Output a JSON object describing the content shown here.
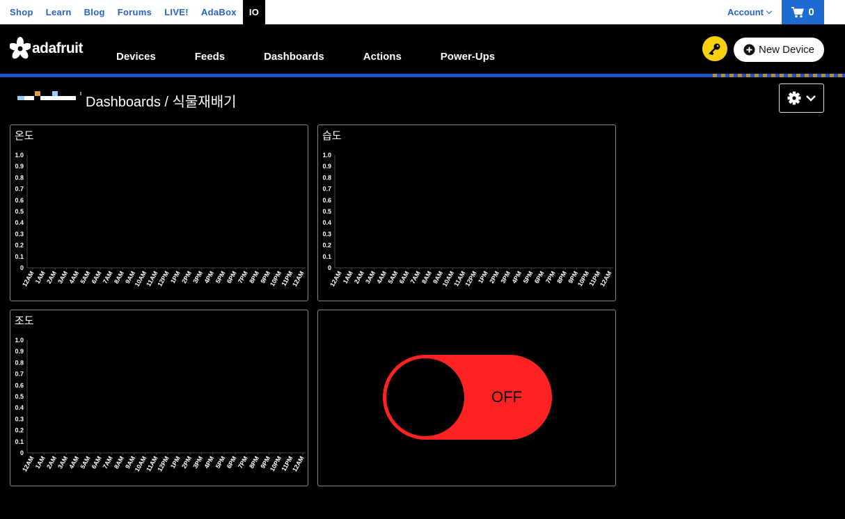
{
  "topnav": {
    "links": [
      "Shop",
      "Learn",
      "Blog",
      "Forums",
      "LIVE!",
      "AdaBox",
      "IO"
    ],
    "active": "IO",
    "account_label": "Account",
    "cart_count": "0"
  },
  "header": {
    "logo_text": "adafruit",
    "nav": [
      "Devices",
      "Feeds",
      "Dashboards",
      "Actions",
      "Power-Ups"
    ],
    "new_device_label": "New Device"
  },
  "breadcrumb": {
    "text": "Dashboards / 식물재배기"
  },
  "colors": {
    "accent_blue": "#1a56c5",
    "link_blue": "#2a62c4",
    "key_yellow": "#f7d10b",
    "toggle_red": "#ff2222"
  },
  "blocks": [
    {
      "title": "온도"
    },
    {
      "title": "습도"
    },
    {
      "title": "조도"
    },
    {
      "toggle_label": "OFF",
      "toggle_state": "off"
    }
  ],
  "chart_data": [
    {
      "type": "line",
      "title": "온도",
      "categories": [
        "12AM",
        "1AM",
        "2AM",
        "3AM",
        "4AM",
        "5AM",
        "6AM",
        "7AM",
        "8AM",
        "9AM",
        "10AM",
        "11AM",
        "12PM",
        "1PM",
        "2PM",
        "3PM",
        "4PM",
        "5PM",
        "6PM",
        "7PM",
        "8PM",
        "9PM",
        "10PM",
        "11PM",
        "12AM"
      ],
      "yticks": [
        "0",
        "0.1",
        "0.2",
        "0.3",
        "0.4",
        "0.5",
        "0.6",
        "0.7",
        "0.8",
        "0.9",
        "1.0"
      ],
      "ylim": [
        0,
        1
      ],
      "series": []
    },
    {
      "type": "line",
      "title": "습도",
      "categories": [
        "12AM",
        "1AM",
        "2AM",
        "3AM",
        "4AM",
        "5AM",
        "6AM",
        "7AM",
        "8AM",
        "9AM",
        "10AM",
        "11AM",
        "12PM",
        "1PM",
        "2PM",
        "3PM",
        "4PM",
        "5PM",
        "6PM",
        "7PM",
        "8PM",
        "9PM",
        "10PM",
        "11PM",
        "12AM"
      ],
      "yticks": [
        "0",
        "0.1",
        "0.2",
        "0.3",
        "0.4",
        "0.5",
        "0.6",
        "0.7",
        "0.8",
        "0.9",
        "1.0"
      ],
      "ylim": [
        0,
        1
      ],
      "series": []
    },
    {
      "type": "line",
      "title": "조도",
      "categories": [
        "12AM",
        "1AM",
        "2AM",
        "3AM",
        "4AM",
        "5AM",
        "6AM",
        "7AM",
        "8AM",
        "9AM",
        "10AM",
        "11AM",
        "12PM",
        "1PM",
        "2PM",
        "3PM",
        "4PM",
        "5PM",
        "6PM",
        "7PM",
        "8PM",
        "9PM",
        "10PM",
        "11PM",
        "12AM"
      ],
      "yticks": [
        "0",
        "0.1",
        "0.2",
        "0.3",
        "0.4",
        "0.5",
        "0.6",
        "0.7",
        "0.8",
        "0.9",
        "1.0"
      ],
      "ylim": [
        0,
        1
      ],
      "series": []
    }
  ]
}
